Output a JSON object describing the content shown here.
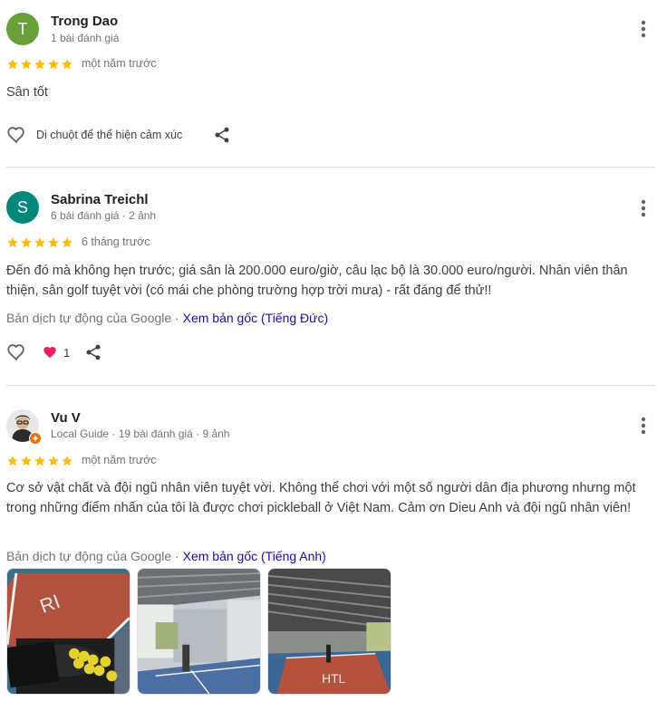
{
  "reviews": [
    {
      "initial": "T",
      "avatar_color": "#689f38",
      "name": "Trong Dao",
      "meta": "1 bài đánh giá",
      "stars": 5,
      "when": "một năm trước",
      "text": "Sân tốt",
      "hover_hint": "Di chuột để thể hiện cảm xúc"
    },
    {
      "initial": "S",
      "avatar_color": "#00897b",
      "name": "Sabrina Treichl",
      "meta": "6 bài đánh giá · 2 ảnh",
      "stars": 5,
      "when": "6 tháng trước",
      "text": "Đến đó mà không hẹn trước; giá sân là 200.000 euro/giờ, câu lạc bộ là 30.000 euro/người. Nhân viên thân thiện, sân golf tuyệt vời (có mái che phòng trường hợp trời mưa) - rất đáng để thử!!",
      "translated_label": "Bản dịch tự động của Google · ",
      "original_link": "Xem bản gốc (Tiếng Đức)",
      "reaction_count": "1"
    },
    {
      "name": "Vu V",
      "meta_guide": "Local Guide",
      "meta": " · 19 bài đánh giá · 9 ảnh",
      "stars": 5,
      "when": "một năm trước",
      "text": "Cơ sở vật chất và đội ngũ nhân viên tuyệt vời. Không thể chơi với một số người dân địa phương nhưng một trong những điểm nhấn của tôi là được chơi pickleball ở Việt Nam. Cảm ơn Dieu Anh và đội ngũ nhân viên!",
      "translated_label": "Bản dịch tự động của Google · ",
      "original_link": "Xem bản gốc (Tiếng Anh)"
    }
  ],
  "colors": {
    "star": "#fbbc04",
    "link": "#1a0dab",
    "reaction_heart": "#e91e63"
  },
  "icons": [
    "more-vert-icon",
    "heart-outline-icon",
    "share-icon",
    "star-icon",
    "heart-reaction-icon",
    "local-guide-badge-icon"
  ]
}
